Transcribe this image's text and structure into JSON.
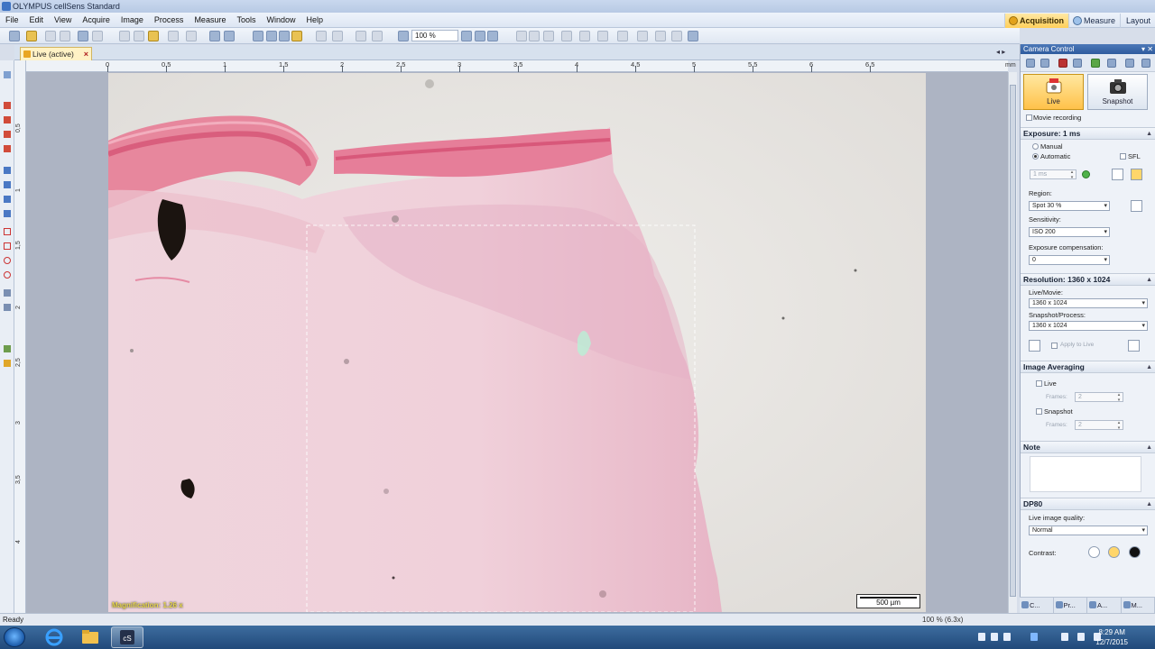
{
  "window": {
    "title": "OLYMPUS cellSens Standard"
  },
  "menu": [
    "File",
    "Edit",
    "View",
    "Acquire",
    "Image",
    "Process",
    "Measure",
    "Tools",
    "Window",
    "Help"
  ],
  "layouts": {
    "acquisition": "Acquisition",
    "measure": "Measure",
    "layout": "Layout"
  },
  "toolbar": {
    "zoom": "100 %"
  },
  "document_tab": {
    "label": "Live (active)",
    "close": "×"
  },
  "ruler": {
    "h_labels": [
      "0",
      "0,5",
      "1",
      "1,5",
      "2",
      "2,5",
      "3",
      "3,5",
      "4",
      "4,5",
      "5",
      "5,5",
      "6",
      "6,5"
    ],
    "v_labels": [
      "0,5",
      "1",
      "1,5",
      "2",
      "2,5",
      "3",
      "3,5",
      "4"
    ],
    "unit": "mm"
  },
  "image": {
    "magnification": "Magnification:  1.26 x",
    "scale_bar": "500 µm"
  },
  "camera_control": {
    "title": "Camera Control",
    "live_label": "Live",
    "snapshot_label": "Snapshot",
    "movie_recording": "Movie recording",
    "exposure": {
      "header": "Exposure: 1 ms",
      "manual": "Manual",
      "automatic": "Automatic",
      "sfl": "SFL",
      "value": "1 ms",
      "region_label": "Region:",
      "region_value": "Spot 30 %",
      "sensitivity_label": "Sensitivity:",
      "sensitivity_value": "ISO 200",
      "compensation_label": "Exposure compensation:",
      "compensation_value": "0"
    },
    "resolution": {
      "header": "Resolution: 1360 x 1024",
      "live_label": "Live/Movie:",
      "live_value": "1360 x 1024",
      "snapshot_label": "Snapshot/Process:",
      "snapshot_value": "1360 x 1024",
      "apply_label": "Apply to Live"
    },
    "averaging": {
      "header": "Image Averaging",
      "live": "Live",
      "snapshot": "Snapshot",
      "frames_label": "Frames:",
      "frames_live": "2",
      "frames_snapshot": "2"
    },
    "note": {
      "header": "Note"
    },
    "dp80": {
      "header": "DP80",
      "quality_label": "Live image quality:",
      "quality_value": "Normal",
      "contrast_label": "Contrast:"
    }
  },
  "panel_tabs": [
    "C...",
    "Pr...",
    "A...",
    "M..."
  ],
  "status": {
    "ready": "Ready",
    "zoom": "100 % (6.3x)"
  },
  "taskbar": {
    "time": "8:29 AM",
    "date": "12/7/2015"
  },
  "colors": {
    "accent": "#ffc24a",
    "titlebar": "#2f5c9e",
    "tissue": "#e9a8bd"
  }
}
